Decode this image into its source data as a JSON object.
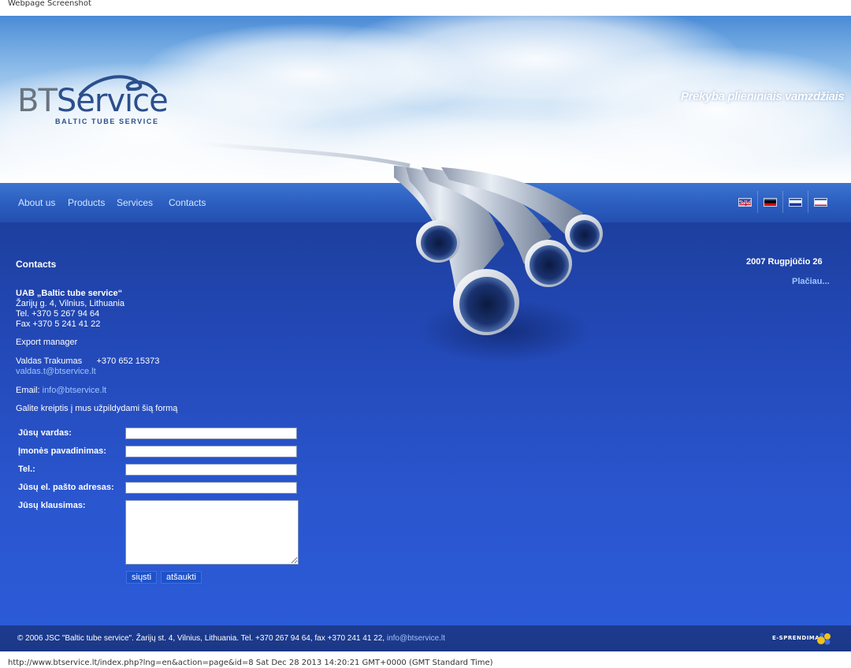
{
  "page": {
    "top_caption": "Webpage Screenshot",
    "bottom_caption": "http://www.btservice.lt/index.php?lng=en&action=page&id=8 Sat Dec 28 2013 14:20:21 GMT+0000 (GMT Standard Time)"
  },
  "header": {
    "logo_bt": "BT",
    "logo_service": "Service",
    "logo_sub": "BALTIC TUBE SERVICE",
    "slogan": "Prekyba plieniniais vamzdžiais"
  },
  "nav": {
    "items": [
      {
        "label": "About us"
      },
      {
        "label": "Products"
      },
      {
        "label": "Services"
      },
      {
        "label": "Contacts"
      }
    ],
    "flags": [
      {
        "icon": "uk-flag-icon"
      },
      {
        "icon": "germany-flag-icon"
      },
      {
        "icon": "russia-flag-icon"
      },
      {
        "icon": "lithuania-flag-icon"
      }
    ]
  },
  "content": {
    "heading": "Contacts",
    "company": "UAB „Baltic tube service“",
    "address": "Žarijų g. 4, Vilnius, Lithuania",
    "tel": "Tel.  +370 5 267 94 64",
    "fax": "Fax +370 5 241 41 22",
    "export_manager": "Export manager",
    "manager_name": "Valdas Trakumas      +370 652 15373",
    "manager_email": "valdas.t@btservice.lt",
    "email_label": "Email: ",
    "email": "info@btservice.lt",
    "form_intro": "Galite kreiptis į mus užpildydami šią formą"
  },
  "form": {
    "name_label": "Jūsų vardas:",
    "company_label": "Įmonės pavadinimas:",
    "tel_label": "Tel.:",
    "email_label": "Jūsų el. pašto adresas:",
    "question_label": "Jūsų klausimas:",
    "submit": "siųsti",
    "cancel": "atšaukti"
  },
  "news": {
    "date": "2007 Rugpjūčio 26",
    "more": "Plačiau..."
  },
  "footer": {
    "text": "© 2006 JSC \"Baltic tube service\". Žarijų st. 4, Vilnius, Lithuania. Tel. +370 267 94 64, fax +370 241 41 22, ",
    "email": "info@btservice.lt",
    "esprendimas": "E-SPRENDIMAS"
  },
  "colors": {
    "nav_blue": "#2c5fc0",
    "main_blue": "#2349b8",
    "footer_blue": "#1d3b8f",
    "link": "#9fc4ff"
  }
}
